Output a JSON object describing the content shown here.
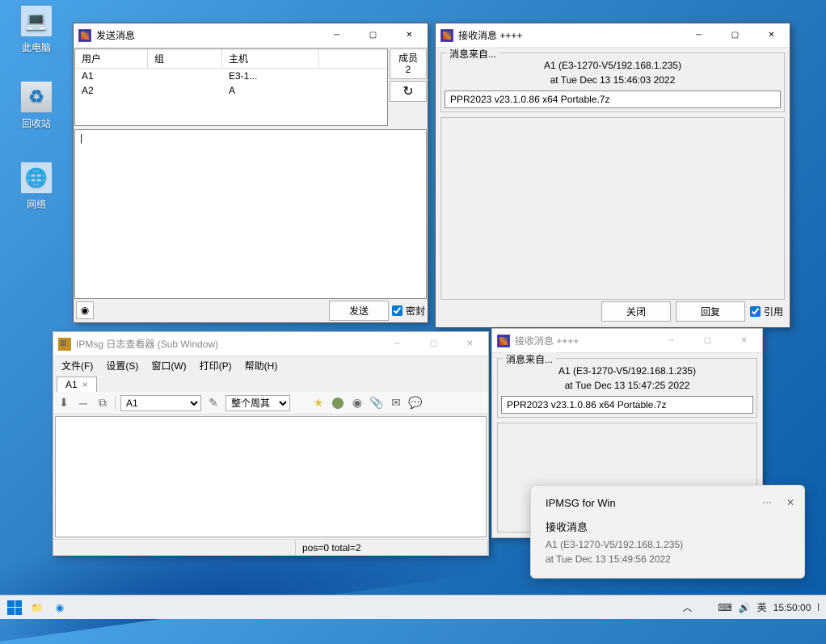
{
  "desktop": {
    "this_pc": "此电脑",
    "recycle": "回收站",
    "network": "网络"
  },
  "send_window": {
    "title": "发送消息",
    "col_user": "用户",
    "col_group": "组",
    "col_host": "主机",
    "rows": [
      {
        "user": "A1",
        "group": "",
        "host": "E3-1..."
      },
      {
        "user": "A2",
        "group": "",
        "host": "A"
      }
    ],
    "member_label": "成员",
    "member_count": "2",
    "message_text": "|",
    "send_btn": "发送",
    "seal_label": "密封",
    "seal_checked": true
  },
  "recv_window_1": {
    "title": "接收消息 ++++",
    "from_legend": "消息来自...",
    "from_line1": "A1 (E3-1270-V5/192.168.1.235)",
    "from_line2": "at Tue Dec 13 15:46:03 2022",
    "file": "PPR2023 v23.1.0.86 x64 Portable.7z",
    "close_btn": "关闭",
    "reply_btn": "回复",
    "quote_label": "引用",
    "quote_checked": true
  },
  "recv_window_2": {
    "title": "接收消息 ++++",
    "from_legend": "消息来自...",
    "from_line1": "A1 (E3-1270-V5/192.168.1.235)",
    "from_line2": "at Tue Dec 13 15:47:25 2022",
    "file": "PPR2023 v23.1.0.86 x64 Portable.7z"
  },
  "log_window": {
    "title": "IPMsg 日志查看器 (Sub Window)",
    "menu": {
      "file": "文件(F)",
      "settings": "设置(S)",
      "window": "窗口(W)",
      "print": "打印(P)",
      "help": "帮助(H)"
    },
    "tab_label": "A1",
    "dropdown_user": "A1",
    "dropdown_period": "整个周其",
    "status": "pos=0 total=2"
  },
  "toast": {
    "app": "IPMSG for Win",
    "heading": "接收消息",
    "line1": "A1 (E3-1270-V5/192.168.1.235)",
    "line2": "at Tue Dec 13 15:49:56 2022"
  },
  "taskbar": {
    "ime_lang": "英",
    "clock": "15:50:00"
  }
}
